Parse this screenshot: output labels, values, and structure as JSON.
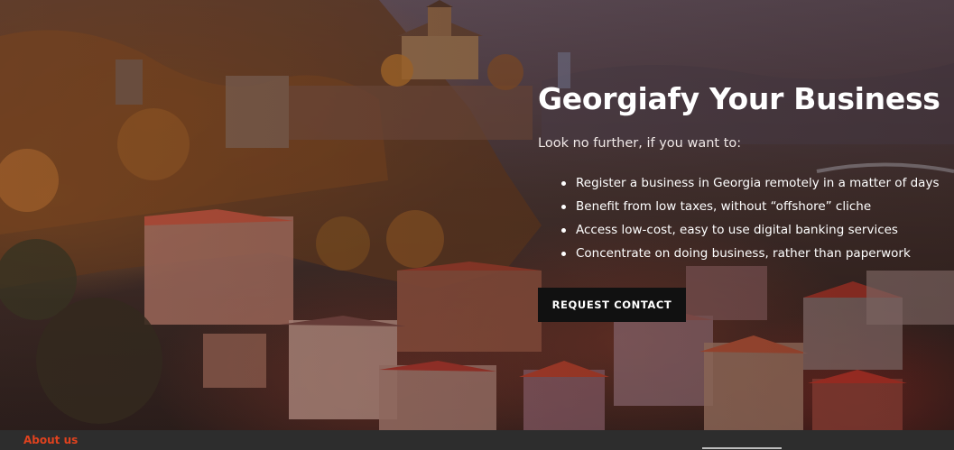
{
  "hero": {
    "headline": "Georgiafy Your Business",
    "lead": "Look no further, if you want to:",
    "bullets": [
      "Register a business in Georgia remotely in a matter of days",
      "Benefit from low taxes, without “offshore” cliche",
      "Access low-cost, easy to use digital banking services",
      "Concentrate on doing business, rather than paperwork"
    ],
    "cta_label": "REQUEST CONTACT"
  },
  "footer": {
    "about_label": "About us"
  },
  "colors": {
    "cta_background": "#111111",
    "accent": "#e0421e",
    "footer_background": "#2d2d2d"
  }
}
